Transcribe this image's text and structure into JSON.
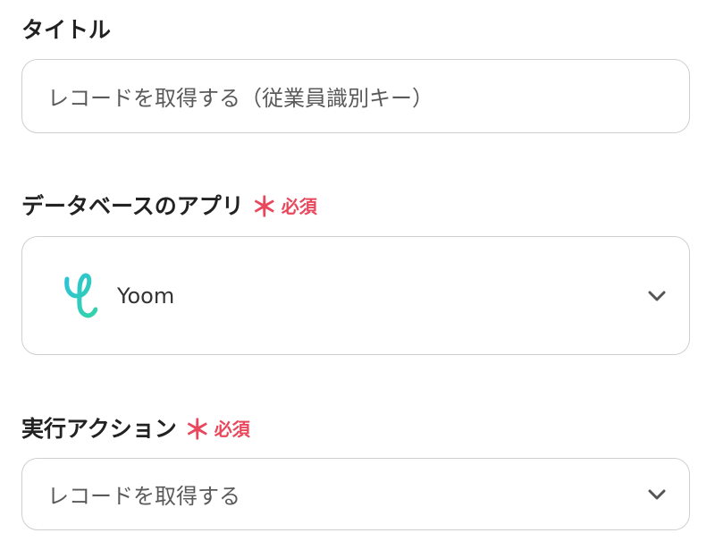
{
  "title_section": {
    "label": "タイトル",
    "value": "レコードを取得する（従業員識別キー）"
  },
  "database_app_section": {
    "label": "データベースのアプリ",
    "required_mark": "＊",
    "required_text": "必須",
    "selected_app": "Yoom",
    "app_icon": "yoom-logo-icon"
  },
  "action_section": {
    "label": "実行アクション",
    "required_mark": "＊",
    "required_text": "必須",
    "selected_value": "レコードを取得する"
  },
  "colors": {
    "required": "#e8475c",
    "border": "#cfcfcf",
    "logo_gradient_start": "#2bc3d8",
    "logo_gradient_end": "#33d3a8"
  },
  "icons": {
    "dropdown": "chevron-down-icon"
  }
}
